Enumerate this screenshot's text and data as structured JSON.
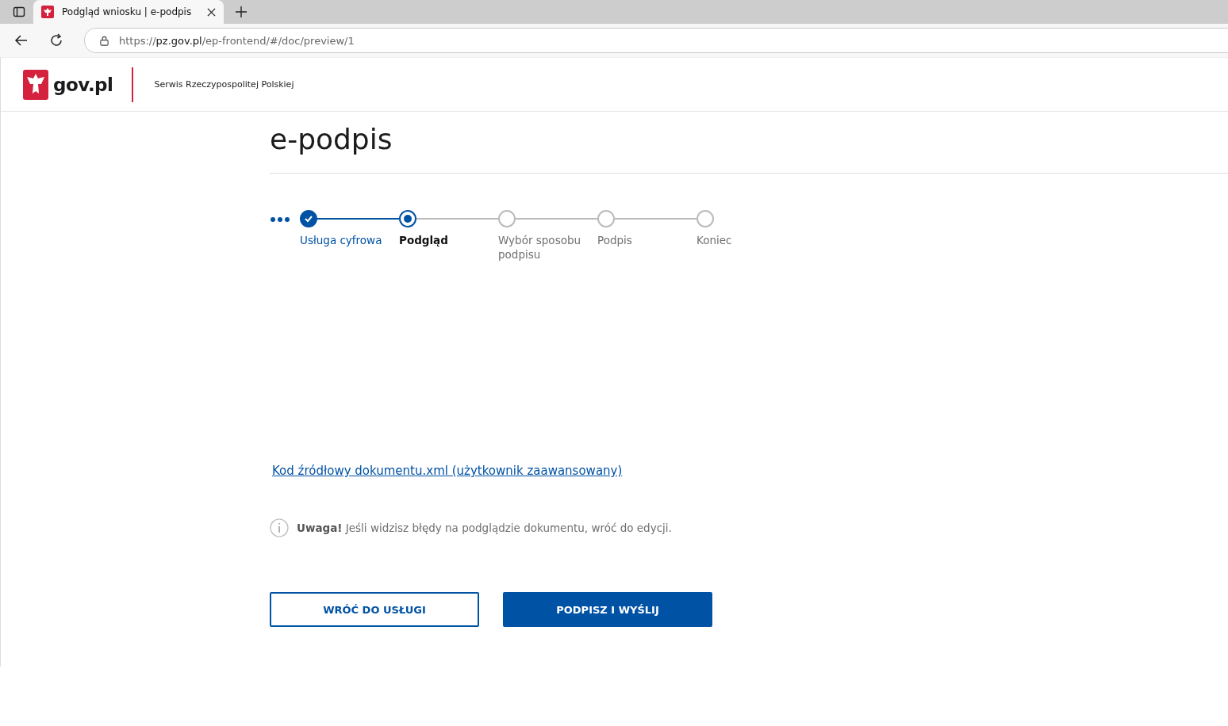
{
  "browser": {
    "tab_title": "Podgląd wniosku | e-podpis",
    "url": "https://**pz.gov.pl**/ep-frontend/#/doc/preview/1"
  },
  "header": {
    "logo_text": "gov.pl",
    "service_name": "Serwis Rzeczypospolitej Polskiej"
  },
  "page_title": "e-podpis",
  "steps": [
    {
      "label": "Usługa cyfrowa",
      "completed": true,
      "selected": false
    },
    {
      "label": "Podgląd",
      "completed": false,
      "selected": true
    },
    {
      "label": "Wybór sposobu podpisu",
      "completed": false,
      "selected": false
    },
    {
      "label": "Podpis",
      "completed": false,
      "selected": false
    },
    {
      "label": "Koniec",
      "completed": false,
      "selected": false
    }
  ],
  "source_link": "Kod źródłowy dokumentu.xml (użytkownik zaawansowany)",
  "notice": "**Uwaga!** Jeśli widzisz błędy na podglądzie dokumentu, wróć do edycji.",
  "buttons": [
    {
      "label": "WRÓĆ DO USŁUGI",
      "kind": "secondary"
    },
    {
      "label": "PODPISZ I WYŚLIJ",
      "kind": "primary"
    }
  ]
}
